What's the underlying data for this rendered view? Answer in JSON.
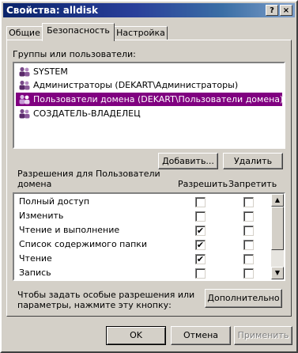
{
  "window": {
    "title": "Свойства: alldisk",
    "help_btn": "?",
    "close_btn": "×"
  },
  "tabs": [
    {
      "label": "Общие"
    },
    {
      "label": "Безопасность",
      "active": true
    },
    {
      "label": "Настройка"
    }
  ],
  "groups": {
    "label": "Группы или пользователи:",
    "items": [
      {
        "label": "SYSTEM"
      },
      {
        "label": "Администраторы (DEKART\\Администраторы)"
      },
      {
        "label": "Пользователи домена (DEKART\\Пользователи домена)",
        "selected": true
      },
      {
        "label": "СОЗДАТЕЛЬ-ВЛАДЕЛЕЦ"
      }
    ],
    "add_btn": "Добавить...",
    "remove_btn": "Удалить"
  },
  "permissions": {
    "label_line1": "Разрешения для Пользователи",
    "label_line2": "домена",
    "allow_header": "Разрешить",
    "deny_header": "Запретить",
    "rows": [
      {
        "label": "Полный доступ",
        "allow": false,
        "deny": false
      },
      {
        "label": "Изменить",
        "allow": false,
        "deny": false
      },
      {
        "label": "Чтение и выполнение",
        "allow": true,
        "deny": false
      },
      {
        "label": "Список содержимого папки",
        "allow": true,
        "deny": false
      },
      {
        "label": "Чтение",
        "allow": true,
        "deny": false
      },
      {
        "label": "Запись",
        "allow": false,
        "deny": false
      }
    ],
    "check_mark": "✔"
  },
  "special": {
    "text_line1": "Чтобы задать особые разрешения или",
    "text_line2": "параметры, нажмите эту кнопку:",
    "advanced_btn": "Дополнительно"
  },
  "footer": {
    "ok": "OK",
    "cancel": "Отмена",
    "apply": "Применить"
  },
  "colors": {
    "titlebar": "#0a246a",
    "selection": "#800080",
    "face": "#d4d0c8"
  }
}
